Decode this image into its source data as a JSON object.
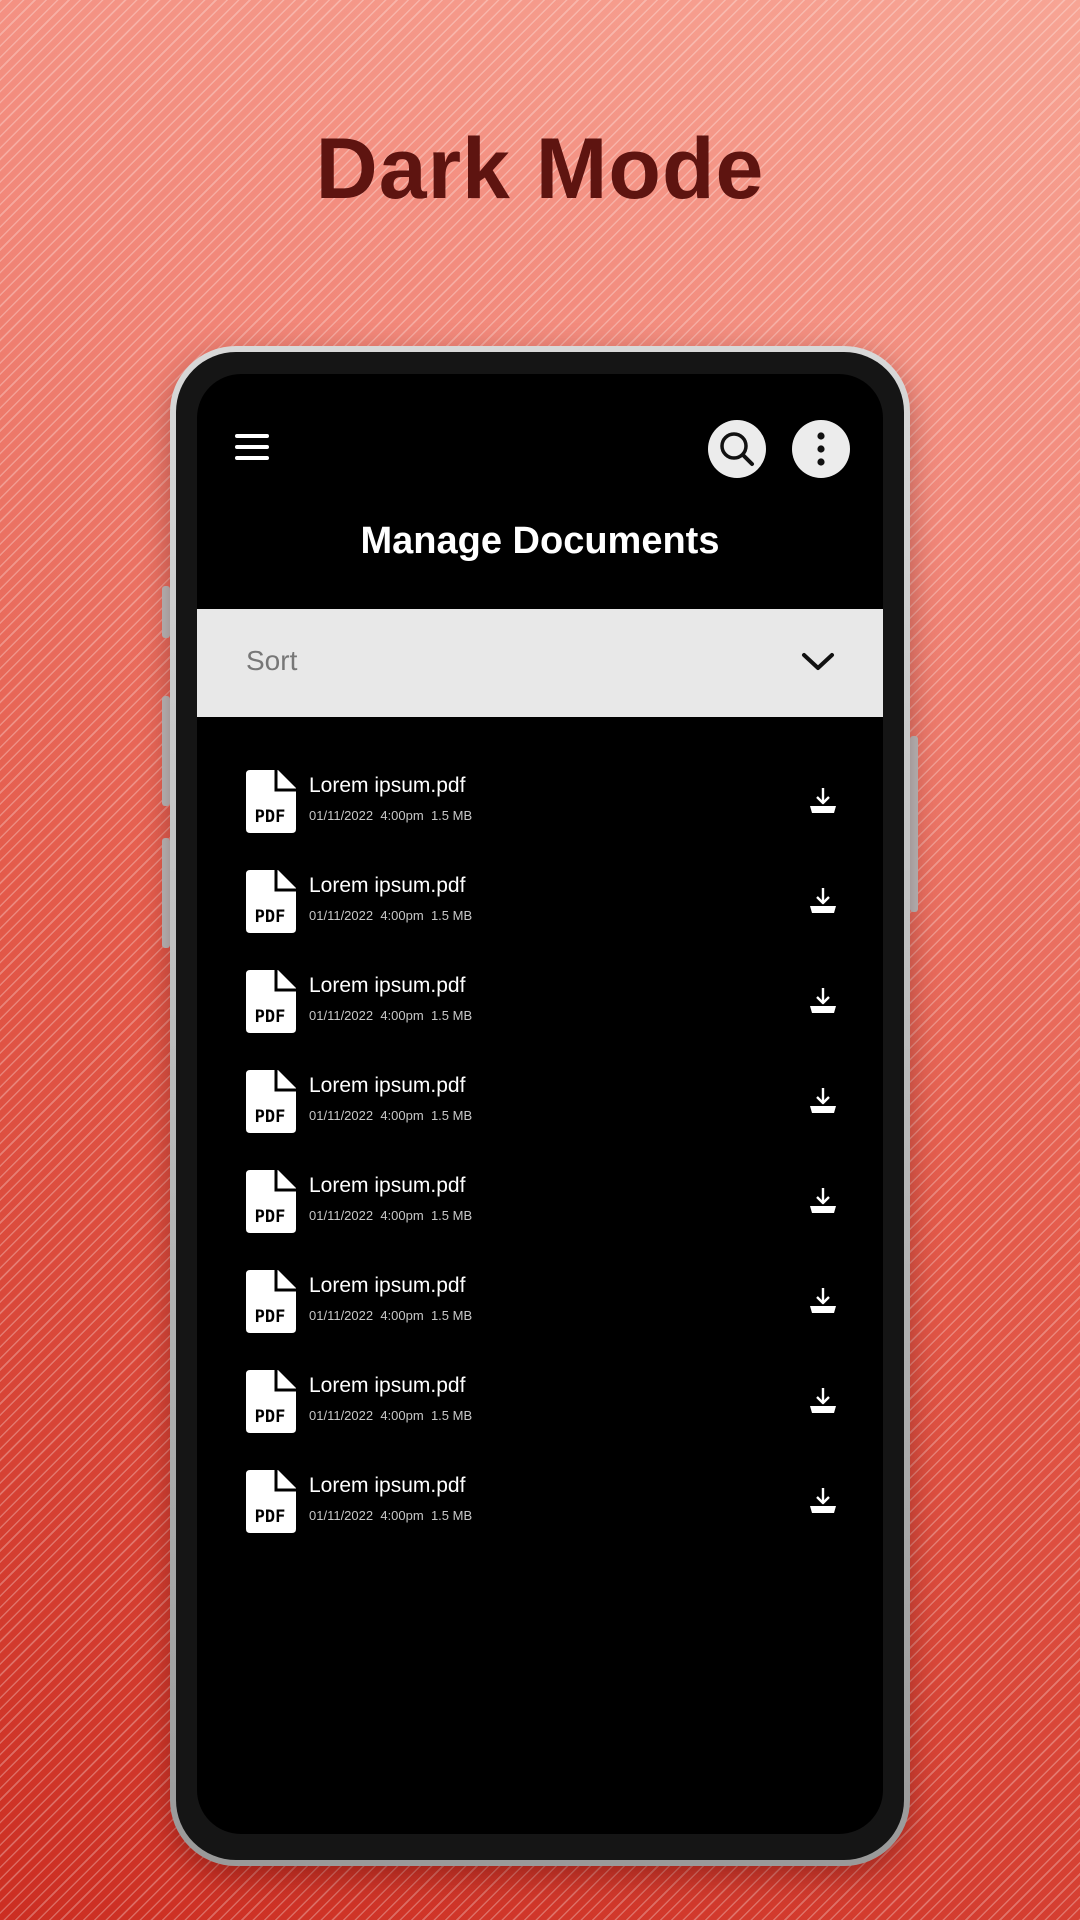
{
  "hero": {
    "title": "Dark Mode"
  },
  "header": {
    "title": "Manage Documents"
  },
  "sort": {
    "label": "Sort"
  },
  "documents": [
    {
      "name": "Lorem ipsum.pdf",
      "date": "01/11/2022",
      "time": "4:00pm",
      "size": "1.5 MB",
      "badge": "PDF"
    },
    {
      "name": "Lorem ipsum.pdf",
      "date": "01/11/2022",
      "time": "4:00pm",
      "size": "1.5 MB",
      "badge": "PDF"
    },
    {
      "name": "Lorem ipsum.pdf",
      "date": "01/11/2022",
      "time": "4:00pm",
      "size": "1.5 MB",
      "badge": "PDF"
    },
    {
      "name": "Lorem ipsum.pdf",
      "date": "01/11/2022",
      "time": "4:00pm",
      "size": "1.5 MB",
      "badge": "PDF"
    },
    {
      "name": "Lorem ipsum.pdf",
      "date": "01/11/2022",
      "time": "4:00pm",
      "size": "1.5 MB",
      "badge": "PDF"
    },
    {
      "name": "Lorem ipsum.pdf",
      "date": "01/11/2022",
      "time": "4:00pm",
      "size": "1.5 MB",
      "badge": "PDF"
    },
    {
      "name": "Lorem ipsum.pdf",
      "date": "01/11/2022",
      "time": "4:00pm",
      "size": "1.5 MB",
      "badge": "PDF"
    },
    {
      "name": "Lorem ipsum.pdf",
      "date": "01/11/2022",
      "time": "4:00pm",
      "size": "1.5 MB",
      "badge": "PDF"
    }
  ],
  "icons": {
    "menu": "hamburger-menu-icon",
    "search": "search-icon",
    "more": "more-vertical-icon",
    "chevron": "chevron-down-icon",
    "file": "pdf-file-icon",
    "download": "download-icon"
  },
  "colors": {
    "screen": "#000000",
    "text": "#ffffff",
    "sortBar": "#e8e8e8",
    "heroTitle": "#5e1410"
  }
}
